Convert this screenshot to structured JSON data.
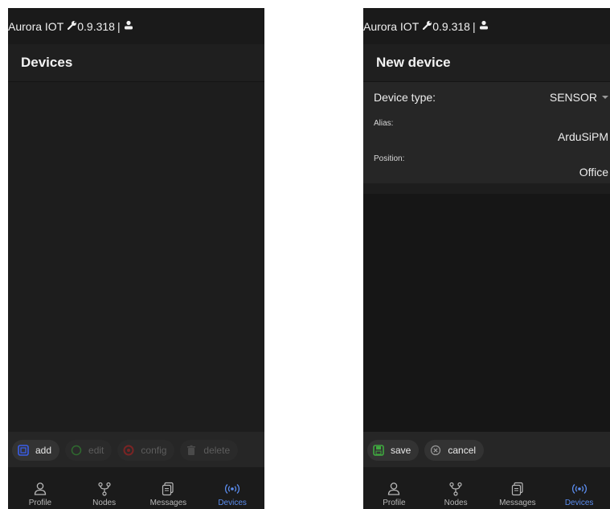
{
  "status_bar": {
    "app_name": "Aurora IOT",
    "version": "0.9.318",
    "separator": "|"
  },
  "left_screen": {
    "title": "Devices",
    "actions": [
      {
        "label": "add",
        "enabled": true
      },
      {
        "label": "edit",
        "enabled": false
      },
      {
        "label": "config",
        "enabled": false
      },
      {
        "label": "delete",
        "enabled": false
      }
    ]
  },
  "right_screen": {
    "title": "New device",
    "form": {
      "device_type_label": "Device type:",
      "device_type_value": "SENSOR",
      "alias_label": "Alias:",
      "alias_value": "ArduSiPM",
      "position_label": "Position:",
      "position_value": "Office"
    },
    "actions": [
      {
        "label": "save"
      },
      {
        "label": "cancel"
      }
    ]
  },
  "nav": {
    "items": [
      {
        "label": "Profile",
        "icon": "person-icon"
      },
      {
        "label": "Nodes",
        "icon": "nodes-icon"
      },
      {
        "label": "Messages",
        "icon": "messages-icon"
      },
      {
        "label": "Devices",
        "icon": "broadcast-icon"
      }
    ],
    "active": "Devices"
  },
  "colors": {
    "background": "#1d1d1d",
    "accent": "#5b8def",
    "add_icon": "#3a5ee8",
    "save_icon": "#3fa83f",
    "edit_icon_disabled": "#2f6a2f",
    "config_icon_disabled": "#7a2424"
  }
}
